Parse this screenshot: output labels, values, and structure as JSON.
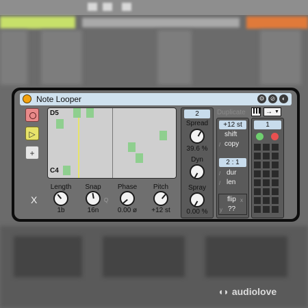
{
  "device": {
    "title": "Note Looper",
    "header_buttons": [
      "settings-icon",
      "link-icon",
      "collapse-icon"
    ]
  },
  "grid": {
    "top_note": "D5",
    "bottom_note": "C4",
    "steps": 16
  },
  "knobs": [
    {
      "label": "Length",
      "value": "1b"
    },
    {
      "label": "Snap",
      "value": "16n"
    },
    {
      "label": "Phase",
      "value": "0.00 ø"
    },
    {
      "label": "Pitch",
      "value": "+12 st"
    }
  ],
  "snap_q": "Q",
  "x_label": "X",
  "spread": {
    "count": "2",
    "spread_label": "Spread",
    "spread_value": "39.6 %",
    "dyn_label": "Dyn",
    "spray_label": "Spray",
    "spray_value": "0.00 %"
  },
  "duplicate": {
    "label": "Duplicate",
    "direction": "→",
    "pitch_header": "+12 st",
    "shift": "shift",
    "copy": "copy",
    "ratio_header": "2 : 1",
    "dur": "dur",
    "len": "len",
    "flip": "flip",
    "qq": "??",
    "x_mark": "x",
    "y_mark": "y"
  },
  "matrix": {
    "header": "1",
    "led_green": "#6fcf6f",
    "led_red": "#e85050"
  },
  "colors": {
    "accent_title": "#cfe1ee",
    "note_green": "#8fcf8f",
    "power": "#f4a30f"
  },
  "watermark": "audiolove"
}
